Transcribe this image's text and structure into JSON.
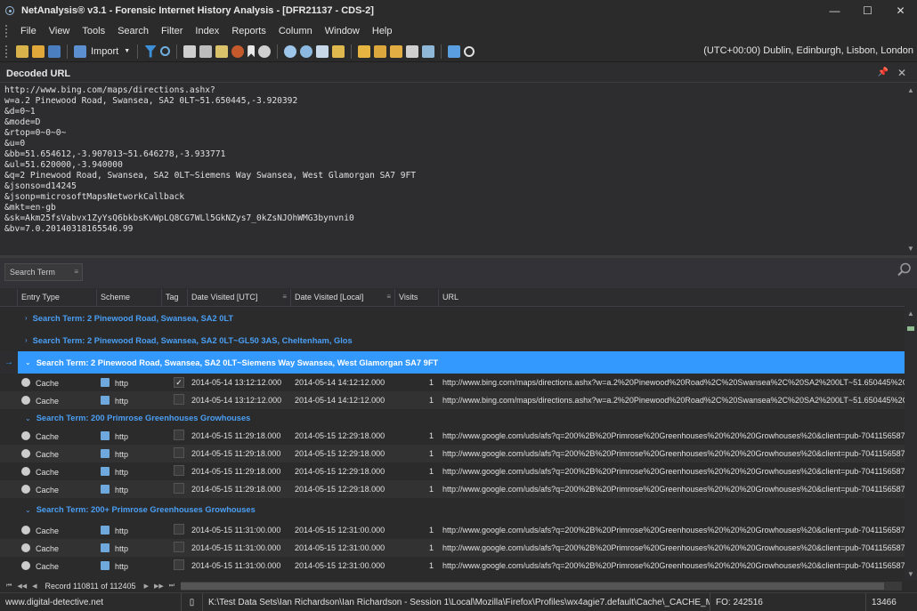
{
  "window": {
    "title": "NetAnalysis® v3.1 - Forensic Internet History Analysis - [DFR21137 - CDS-2]",
    "minimize": "—",
    "maximize": "☐",
    "close": "✕"
  },
  "menu": [
    "File",
    "View",
    "Tools",
    "Search",
    "Filter",
    "Index",
    "Reports",
    "Column",
    "Window",
    "Help"
  ],
  "toolbar": {
    "import_label": "Import",
    "timezone": "(UTC+00:00) Dublin, Edinburgh, Lisbon, London"
  },
  "decoded_panel": {
    "title": "Decoded URL",
    "lines": [
      "http://www.bing.com/maps/directions.ashx?",
      "w=a.2 Pinewood Road, Swansea, SA2 0LT~51.650445,-3.920392",
      "&d=0~1",
      "&mode=D",
      "&rtop=0~0~0~",
      "&u=0",
      "&bb=51.654612,-3.907013~51.646278,-3.933771",
      "&ul=51.620000,-3.940000",
      "&q=2 Pinewood Road, Swansea, SA2 0LT~Siemens Way Swansea, West Glamorgan SA7 9FT",
      "&jsonso=d14245",
      "&jsonp=microsoftMapsNetworkCallback",
      "&mkt=en-gb",
      "&sk=Akm25fsVabvx1ZyYsQ6bkbsKvWpLQ8CG7WLl5GkNZys7_0kZsNJOhWMG3bynvni0",
      "&bv=7.0.20140318165546.99"
    ]
  },
  "search_chip": "Search Term",
  "columns": [
    "Entry Type",
    "Scheme",
    "Tag",
    "Date Visited [UTC]",
    "Date Visited [Local]",
    "Visits",
    "URL"
  ],
  "rows": [
    {
      "kind": "group",
      "label": "Search Term: 2 Pinewood Road, Swansea, SA2 0LT"
    },
    {
      "kind": "group",
      "label": "Search Term: 2 Pinewood Road, Swansea, SA2 0LT~GL50 3AS, Cheltenham, Glos"
    },
    {
      "kind": "group-selected",
      "label": "Search Term: 2 Pinewood Road, Swansea, SA2 0LT~Siemens Way Swansea, West Glamorgan SA7 9FT"
    },
    {
      "kind": "data",
      "type": "Cache",
      "scheme": "http",
      "tag": "✓",
      "utc": "2014-05-14 13:12:12.000",
      "local": "2014-05-14 14:12:12.000",
      "visits": "1",
      "url": "http://www.bing.com/maps/directions.ashx?w=a.2%20Pinewood%20Road%2C%20Swansea%2C%20SA2%200LT~51.650445%2C"
    },
    {
      "kind": "data",
      "type": "Cache",
      "scheme": "http",
      "tag": "",
      "utc": "2014-05-14 13:12:12.000",
      "local": "2014-05-14 14:12:12.000",
      "visits": "1",
      "url": "http://www.bing.com/maps/directions.ashx?w=a.2%20Pinewood%20Road%2C%20Swansea%2C%20SA2%200LT~51.650445%2C"
    },
    {
      "kind": "group",
      "label": "Search Term: 200  Primrose Greenhouses   Growhouses"
    },
    {
      "kind": "data",
      "type": "Cache",
      "scheme": "http",
      "tag": "",
      "utc": "2014-05-15 11:29:18.000",
      "local": "2014-05-15 12:29:18.000",
      "visits": "1",
      "url": "http://www.google.com/uds/afs?q=200%2B%20Primrose%20Greenhouses%20%20%20Growhouses%20&client=pub-70411565879"
    },
    {
      "kind": "data",
      "type": "Cache",
      "scheme": "http",
      "tag": "",
      "utc": "2014-05-15 11:29:18.000",
      "local": "2014-05-15 12:29:18.000",
      "visits": "1",
      "url": "http://www.google.com/uds/afs?q=200%2B%20Primrose%20Greenhouses%20%20%20Growhouses%20&client=pub-70411565879"
    },
    {
      "kind": "data",
      "type": "Cache",
      "scheme": "http",
      "tag": "",
      "utc": "2014-05-15 11:29:18.000",
      "local": "2014-05-15 12:29:18.000",
      "visits": "1",
      "url": "http://www.google.com/uds/afs?q=200%2B%20Primrose%20Greenhouses%20%20%20Growhouses%20&client=pub-70411565879"
    },
    {
      "kind": "data",
      "type": "Cache",
      "scheme": "http",
      "tag": "",
      "utc": "2014-05-15 11:29:18.000",
      "local": "2014-05-15 12:29:18.000",
      "visits": "1",
      "url": "http://www.google.com/uds/afs?q=200%2B%20Primrose%20Greenhouses%20%20%20Growhouses%20&client=pub-70411565879"
    },
    {
      "kind": "group",
      "label": "Search Term: 200+ Primrose Greenhouses   Growhouses"
    },
    {
      "kind": "data",
      "type": "Cache",
      "scheme": "http",
      "tag": "",
      "utc": "2014-05-15 11:31:00.000",
      "local": "2014-05-15 12:31:00.000",
      "visits": "1",
      "url": "http://www.google.com/uds/afs?q=200%2B%20Primrose%20Greenhouses%20%20%20Growhouses%20&client=pub-70411565879"
    },
    {
      "kind": "data",
      "type": "Cache",
      "scheme": "http",
      "tag": "",
      "utc": "2014-05-15 11:31:00.000",
      "local": "2014-05-15 12:31:00.000",
      "visits": "1",
      "url": "http://www.google.com/uds/afs?q=200%2B%20Primrose%20Greenhouses%20%20%20Growhouses%20&client=pub-70411565879"
    },
    {
      "kind": "data",
      "type": "Cache",
      "scheme": "http",
      "tag": "",
      "utc": "2014-05-15 11:31:00.000",
      "local": "2014-05-15 12:31:00.000",
      "visits": "1",
      "url": "http://www.google.com/uds/afs?q=200%2B%20Primrose%20Greenhouses%20%20%20Growhouses%20&client=pub-70411565879"
    }
  ],
  "navigator": {
    "record_text": "Record 110811 of 112405"
  },
  "status": {
    "website": "www.digital-detective.net",
    "path": "K:\\Test Data Sets\\Ian Richardson\\Ian Richardson - Session 1\\Local\\Mozilla\\Firefox\\Profiles\\wx4agie7.default\\Cache\\_CACHE_MAP_",
    "offset": "FO: 242516",
    "count": "13466"
  }
}
